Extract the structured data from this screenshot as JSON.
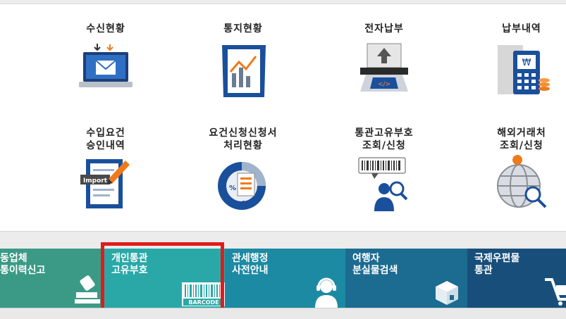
{
  "menu": {
    "items": [
      {
        "label": "수신현황",
        "icon": "laptop-mail-icon"
      },
      {
        "label": "통지현황",
        "icon": "chart-report-icon"
      },
      {
        "label": "전자납부",
        "icon": "electronic-payment-icon"
      },
      {
        "label": "납부내역",
        "icon": "payment-history-icon"
      },
      {
        "label": "수입요건\n승인내역",
        "icon": "import-approval-icon"
      },
      {
        "label": "요건신청신청서\n처리현황",
        "icon": "pie-document-icon"
      },
      {
        "label": "통관고유부호\n조회/신청",
        "icon": "barcode-search-icon"
      },
      {
        "label": "해외거래처\n조회/신청",
        "icon": "globe-search-icon"
      }
    ]
  },
  "tiles": [
    {
      "label": "동업체\n통이력신고",
      "icon": "stamp-icon",
      "color": "#3b9a86"
    },
    {
      "label": "개인통관\n고유부호",
      "icon": "barcode-icon",
      "barcode_text": "BARCODE",
      "color": "#2aa8a8"
    },
    {
      "label": "관세행정\n사전안내",
      "icon": "headset-agent-icon",
      "color": "#1c8aa3"
    },
    {
      "label": "여행자\n분실물검색",
      "icon": "lost-box-icon",
      "color": "#1c6b91"
    },
    {
      "label": "국제우편물\n통관",
      "icon": "cart-icon",
      "color": "#184f7a"
    }
  ],
  "highlight_color": "#e11b1b"
}
